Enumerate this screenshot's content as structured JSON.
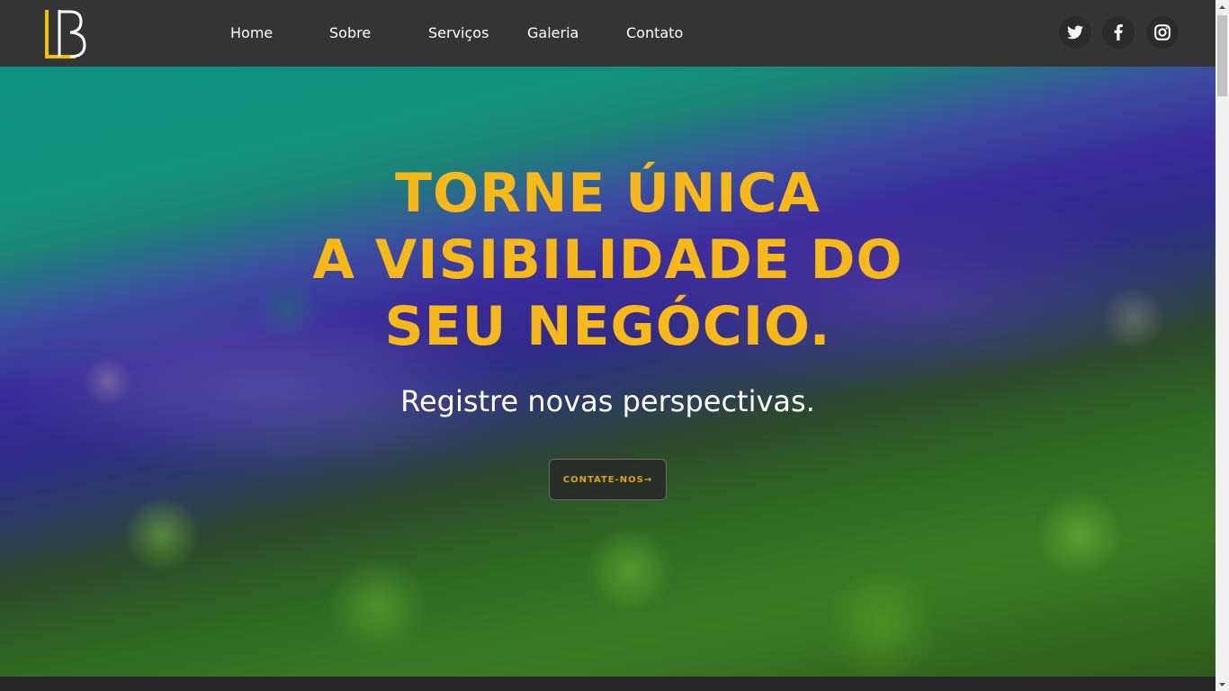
{
  "brand": {
    "logo_icon": "lb-monogram-logo",
    "logo_colors": {
      "l": "#f2c200",
      "b": "#ffffff"
    }
  },
  "nav": {
    "items": [
      {
        "label": "Home"
      },
      {
        "label": "Sobre"
      },
      {
        "label": "Serviços"
      },
      {
        "label": "Galeria"
      },
      {
        "label": "Contato"
      }
    ]
  },
  "social": [
    {
      "icon": "twitter-icon"
    },
    {
      "icon": "facebook-icon"
    },
    {
      "icon": "instagram-icon"
    }
  ],
  "hero": {
    "title_lines": [
      "TORNE ÚNICA",
      "A VISIBILIDADE DO",
      "SEU NEGÓCIO."
    ],
    "subtitle": "Registre novas perspectivas.",
    "cta_label": "CONTATE-NOS→",
    "background_image": "aerial-coast-forest-photo"
  },
  "colors": {
    "navbar": "#343434",
    "accent_yellow": "#f7b81a",
    "text_white": "#ffffff"
  }
}
